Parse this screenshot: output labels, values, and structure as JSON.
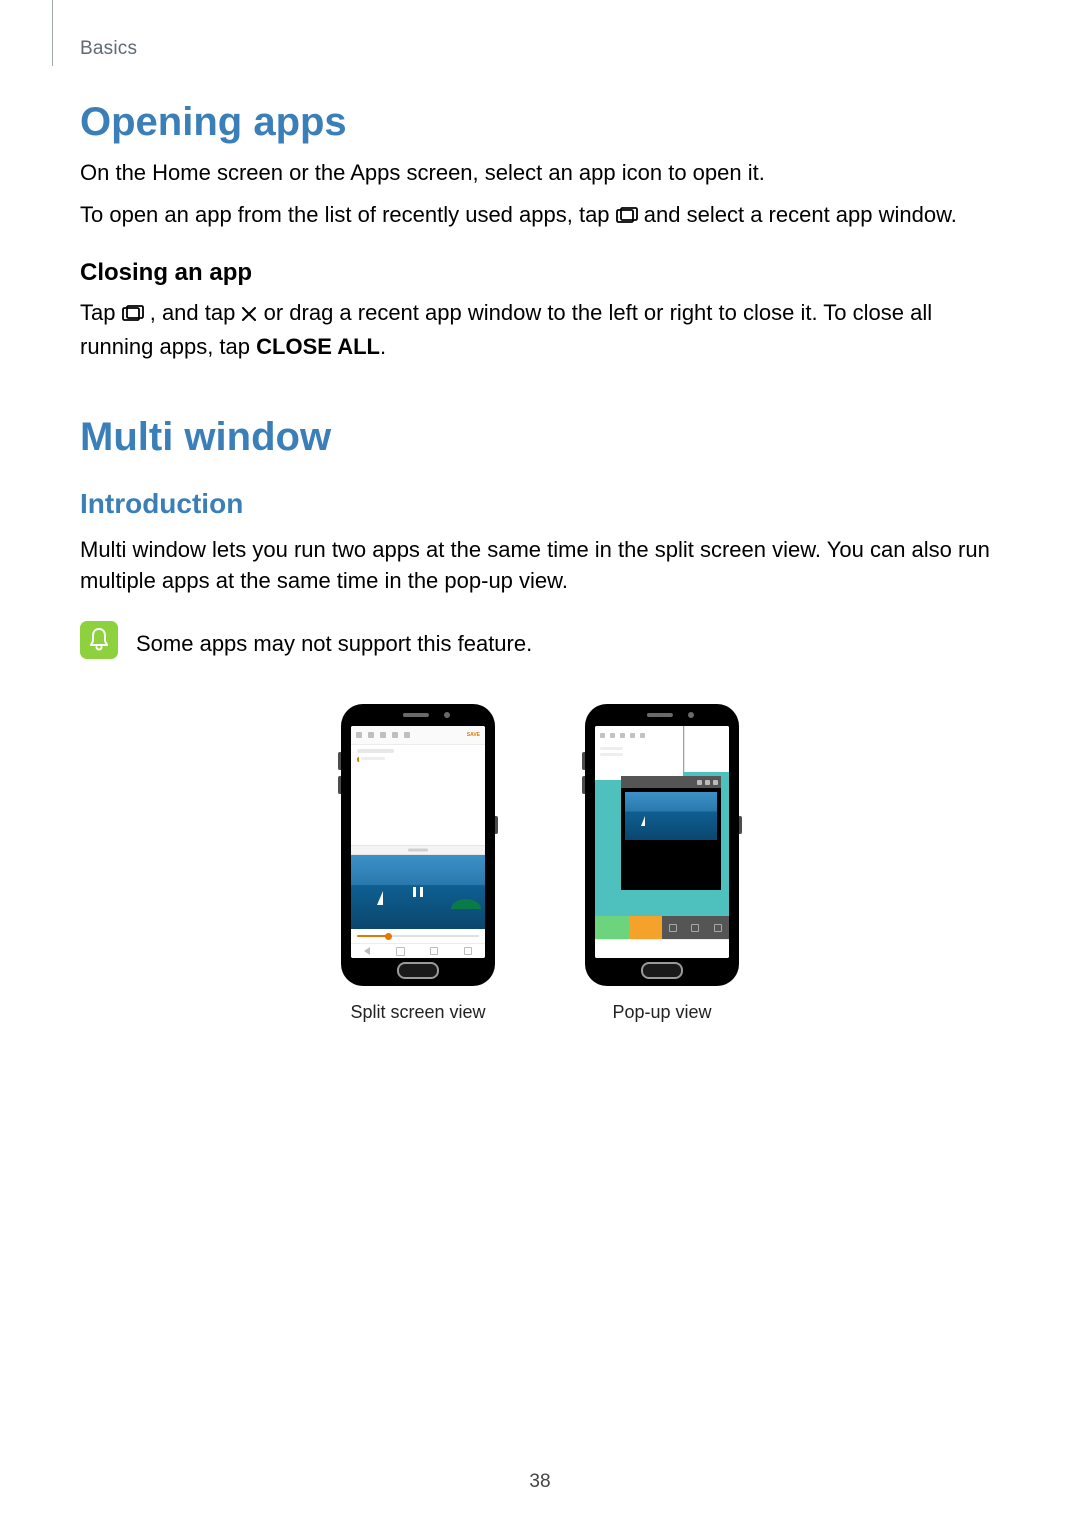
{
  "breadcrumb": "Basics",
  "section1": {
    "title": "Opening apps",
    "p1": "On the Home screen or the Apps screen, select an app icon to open it.",
    "p2_pre": "To open an app from the list of recently used apps, tap ",
    "p2_post": " and select a recent app window.",
    "sub_title": "Closing an app",
    "close_p_pre": "Tap ",
    "close_p_mid1": ", and tap ",
    "close_p_mid2": " or drag a recent app window to the left or right to close it. To close all running apps, tap ",
    "close_all_label": "CLOSE ALL",
    "close_p_end": "."
  },
  "section2": {
    "title": "Multi window",
    "intro_heading": "Introduction",
    "intro_body": "Multi window lets you run two apps at the same time in the split screen view. You can also run multiple apps at the same time in the pop-up view.",
    "notice": "Some apps may not support this feature."
  },
  "phones": {
    "split_caption": "Split screen view",
    "popup_caption": "Pop-up view"
  },
  "page_number": "38"
}
